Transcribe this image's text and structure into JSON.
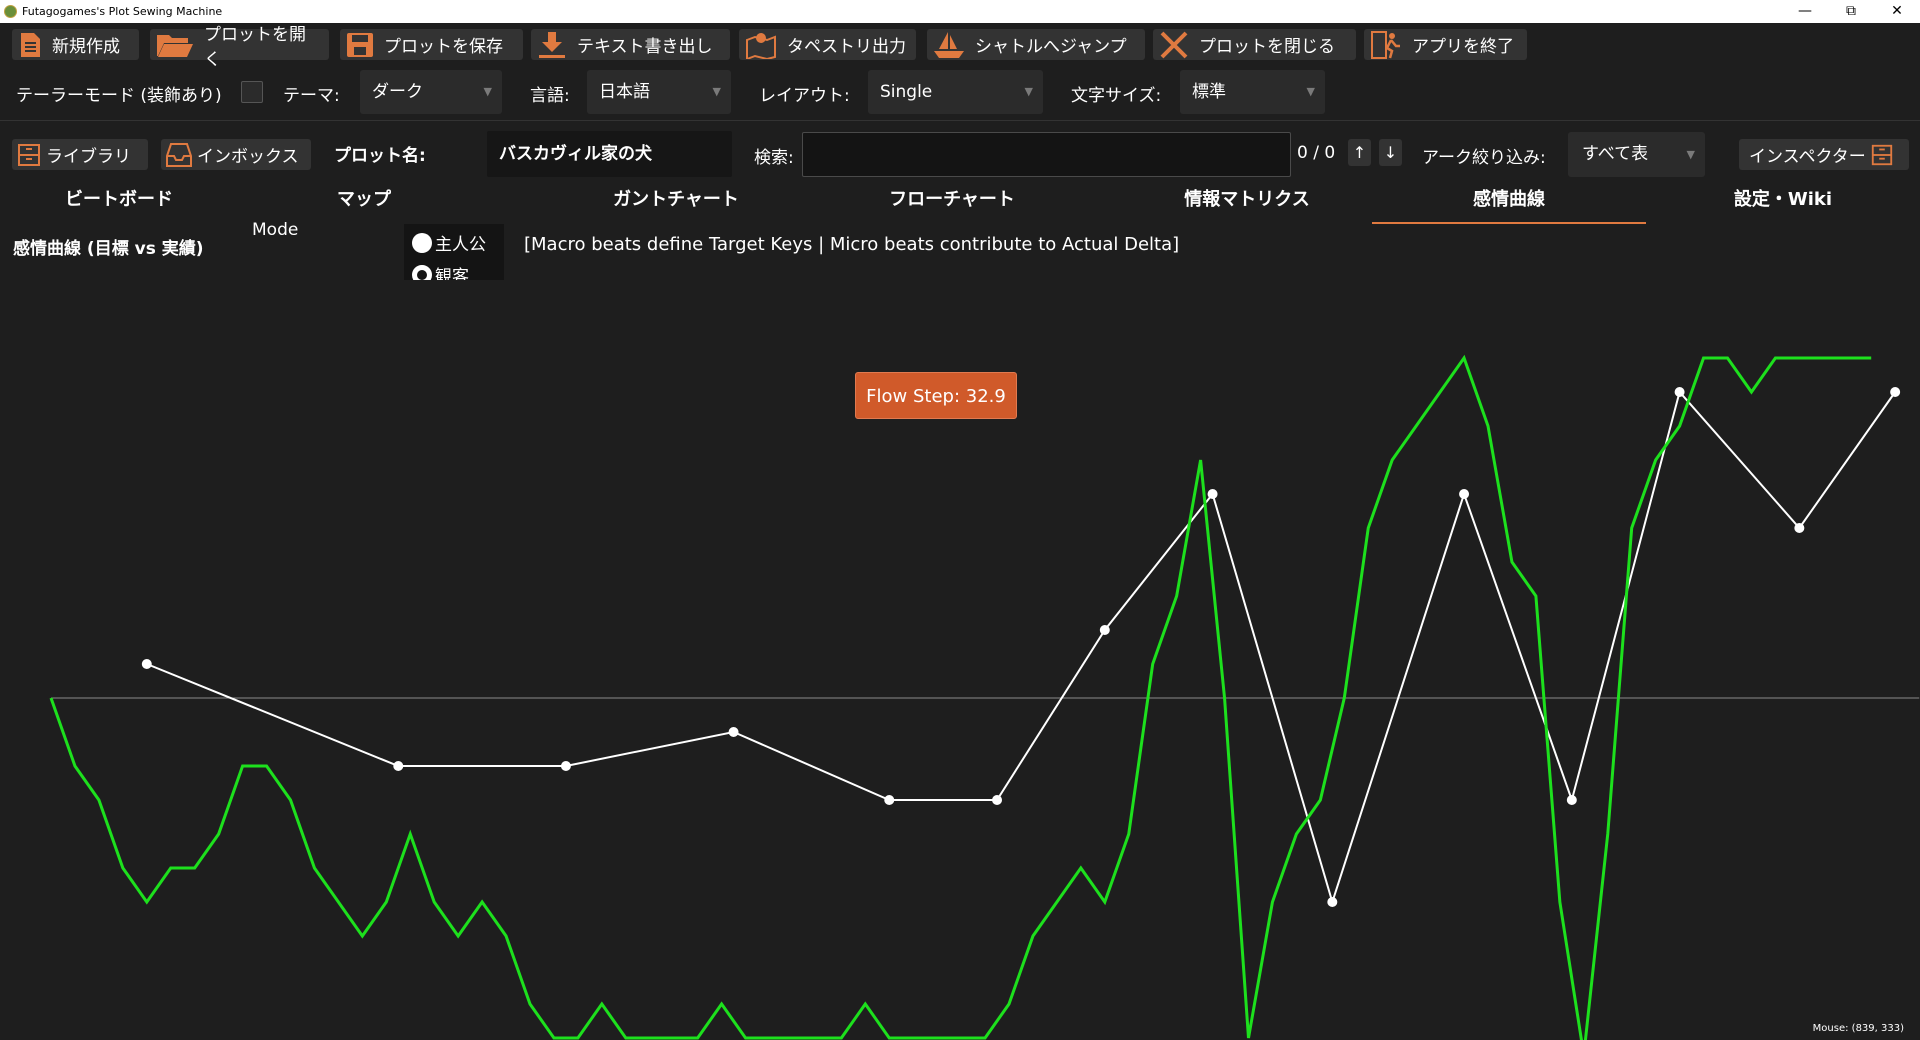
{
  "window": {
    "title": "Futagogames's Plot Sewing Machine",
    "minimize": "—",
    "restore": "⧉",
    "close": "✕"
  },
  "toolbar": {
    "new": "新規作成",
    "open": "プロットを開く",
    "save": "プロットを保存",
    "export_text": "テキスト書き出し",
    "tapestry": "タペストリ出力",
    "shuttle": "シャトルへジャンプ",
    "close_plot": "プロットを閉じる",
    "quit": "アプリを終了"
  },
  "settings": {
    "tailor_mode_label": "テーラーモード (装飾あり)",
    "tailor_mode_checked": false,
    "theme_label": "テーマ:",
    "theme_value": "ダーク",
    "language_label": "言語:",
    "language_value": "日本語",
    "layout_label": "レイアウト:",
    "layout_value": "Single",
    "font_size_label": "文字サイズ:",
    "font_size_value": "標準"
  },
  "plotbar": {
    "library": "ライブラリ",
    "inbox": "インボックス",
    "plot_name_label": "プロット名:",
    "plot_name_value": "バスカヴィル家の犬",
    "search_label": "検索:",
    "search_value": "",
    "match_count": "0 / 0",
    "up": "↑",
    "down": "↓",
    "arc_filter_label": "アーク絞り込み:",
    "arc_filter_value": "すべて表",
    "inspector": "インスペクター"
  },
  "tabs": [
    "ビートボード",
    "マップ",
    "ガントチャート",
    "フローチャート",
    "情報マトリクス",
    "感情曲線",
    "設定・Wiki"
  ],
  "active_tab": 5,
  "curve_panel": {
    "heading": "感情曲線 (目標 vs 実績)",
    "mode_label": "Mode",
    "mode_options": [
      "主人公",
      "観客"
    ],
    "mode_selected": 0,
    "hint": "[Macro beats define Target Keys | Micro beats contribute to Actual Delta]",
    "tooltip": "Flow Step: 32.9",
    "mouse_readout": "Mouse: (839, 333)"
  },
  "colors": {
    "accent": "#e07a40",
    "actual_line": "#1de01d",
    "target_line": "#ffffff",
    "baseline": "#8a8a8a"
  },
  "chart_data": {
    "type": "line",
    "title": "",
    "xlabel": "",
    "ylabel": "",
    "xlim": [
      0,
      76
    ],
    "ylim": [
      -100,
      100
    ],
    "baseline": 0,
    "series": [
      {
        "key": "target",
        "x": [
          4,
          14.5,
          21.5,
          28.5,
          35,
          39.5,
          44,
          48.5,
          53.5,
          59,
          63.5,
          68,
          73,
          77
        ],
        "values": [
          10,
          -20,
          -20,
          -10,
          -30,
          -30,
          20,
          60,
          -60,
          60,
          -30,
          90,
          50,
          90
        ]
      },
      {
        "key": "actual",
        "x": [
          0,
          1,
          2,
          3,
          4,
          5,
          6,
          7,
          8,
          9,
          10,
          11,
          12,
          13,
          14,
          15,
          16,
          17,
          18,
          19,
          20,
          21,
          22,
          23,
          24,
          25,
          26,
          27,
          28,
          29,
          30,
          31,
          32,
          33,
          34,
          35,
          36,
          37,
          38,
          39,
          40,
          41,
          42,
          43,
          44,
          45,
          46,
          47,
          48,
          49,
          50,
          51,
          52,
          53,
          54,
          55,
          56,
          57,
          58,
          59,
          60,
          61,
          62,
          63,
          64,
          65,
          66,
          67,
          68,
          69,
          70,
          71,
          72,
          73,
          74,
          75,
          76
        ],
        "values": [
          0,
          -20,
          -30,
          -50,
          -60,
          -50,
          -50,
          -40,
          -20,
          -20,
          -30,
          -50,
          -60,
          -70,
          -60,
          -40,
          -60,
          -70,
          -60,
          -70,
          -90,
          -100,
          -100,
          -90,
          -100,
          -100,
          -100,
          -100,
          -90,
          -100,
          -100,
          -100,
          -100,
          -100,
          -90,
          -100,
          -100,
          -100,
          -100,
          -100,
          -90,
          -70,
          -60,
          -50,
          -60,
          -40,
          10,
          30,
          70,
          0,
          -100,
          -60,
          -40,
          -30,
          0,
          50,
          70,
          80,
          90,
          100,
          80,
          40,
          30,
          -60,
          -105,
          -40,
          50,
          70,
          80,
          100,
          100,
          90,
          100,
          100,
          100,
          100,
          100
        ]
      }
    ]
  }
}
